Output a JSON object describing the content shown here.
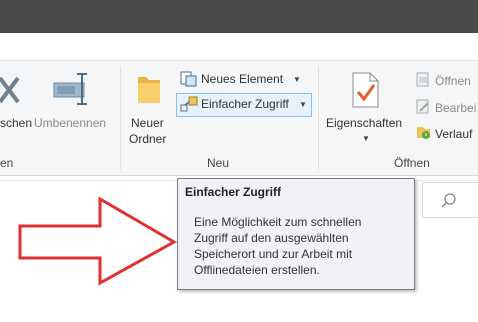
{
  "ribbon": {
    "rename_partial_label": "schen",
    "rename_label": "Umbenennen",
    "new_folder_line1": "Neuer",
    "new_folder_line2": "Ordner",
    "new_element_label": "Neues Element",
    "easy_access_label": "Einfacher Zugriff",
    "properties_label": "Eigenschaften",
    "open_label": "Öffnen",
    "edit_label": "Bearbei",
    "history_label": "Verlauf",
    "group_left_partial": "en",
    "group_new": "Neu",
    "group_open": "Öffnen"
  },
  "tooltip": {
    "title": "Einfacher Zugriff",
    "lines": [
      "Eine Möglichkeit zum schnellen",
      "Zugriff auf den ausgewählten",
      "Speicherort und zur Arbeit mit",
      "Offlinedateien erstellen."
    ]
  },
  "colors": {
    "arrow": "#e03030",
    "folder": "#f2c25c",
    "accent_blue": "#2a78c8",
    "titlebar": "#4a4a4a"
  },
  "icons": {
    "delete": "close-x-icon",
    "rename": "rename-icon",
    "folder": "folder-icon",
    "new_element": "new-item-icon",
    "easy_access": "easy-access-icon",
    "properties": "properties-check-icon",
    "open": "open-icon",
    "edit": "edit-icon",
    "history": "history-icon",
    "search": "search-icon",
    "arrow": "red-arrow-icon"
  }
}
